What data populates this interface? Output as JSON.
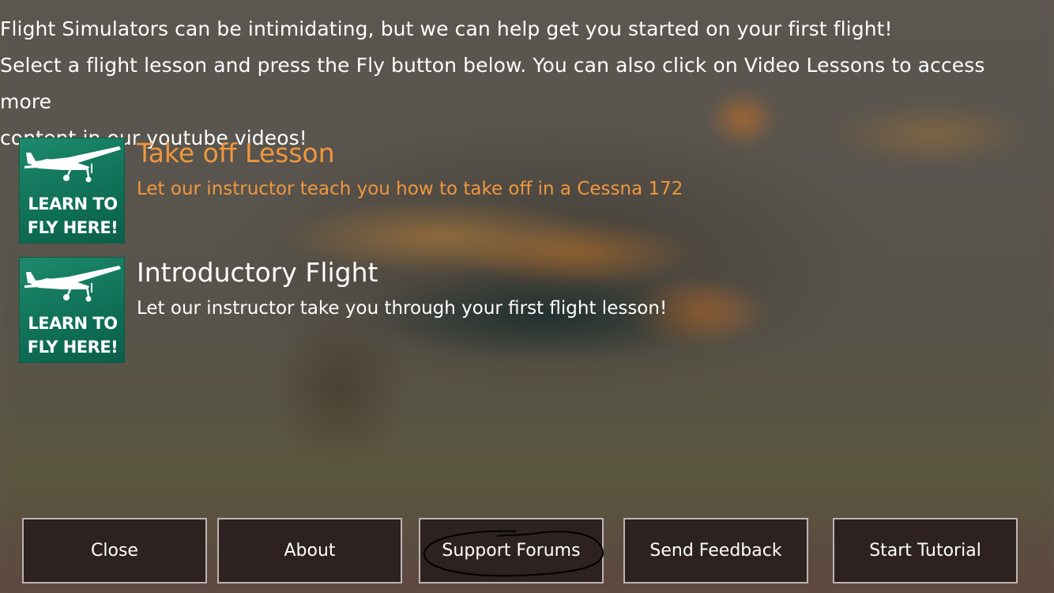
{
  "intro": {
    "line1": "Flight Simulators can be intimidating, but we can help get you started on your first flight!",
    "line2": "Select a flight lesson and press the Fly button below. You can also click on Video Lessons to access more",
    "line3": "content in our youtube videos!"
  },
  "lessons": [
    {
      "title": "Take off Lesson",
      "description": "Let our instructor teach you how to take off in a Cessna 172",
      "thumb_line1": "LEARN TO",
      "thumb_line2": "FLY HERE!",
      "selected": true
    },
    {
      "title": "Introductory Flight",
      "description": "Let our instructor take you through your first flight lesson!",
      "thumb_line1": "LEARN TO",
      "thumb_line2": "FLY HERE!",
      "selected": false
    }
  ],
  "buttons": {
    "close": "Close",
    "about": "About",
    "support_forums": "Support Forums",
    "send_feedback": "Send Feedback",
    "start_tutorial": "Start Tutorial"
  },
  "colors": {
    "selected_text": "#f0973f",
    "thumb_green": "#0f6f56",
    "button_bg": "#281c1c",
    "button_border": "#bdb3b1"
  },
  "icons": {
    "lesson_thumb": "airplane-icon"
  }
}
